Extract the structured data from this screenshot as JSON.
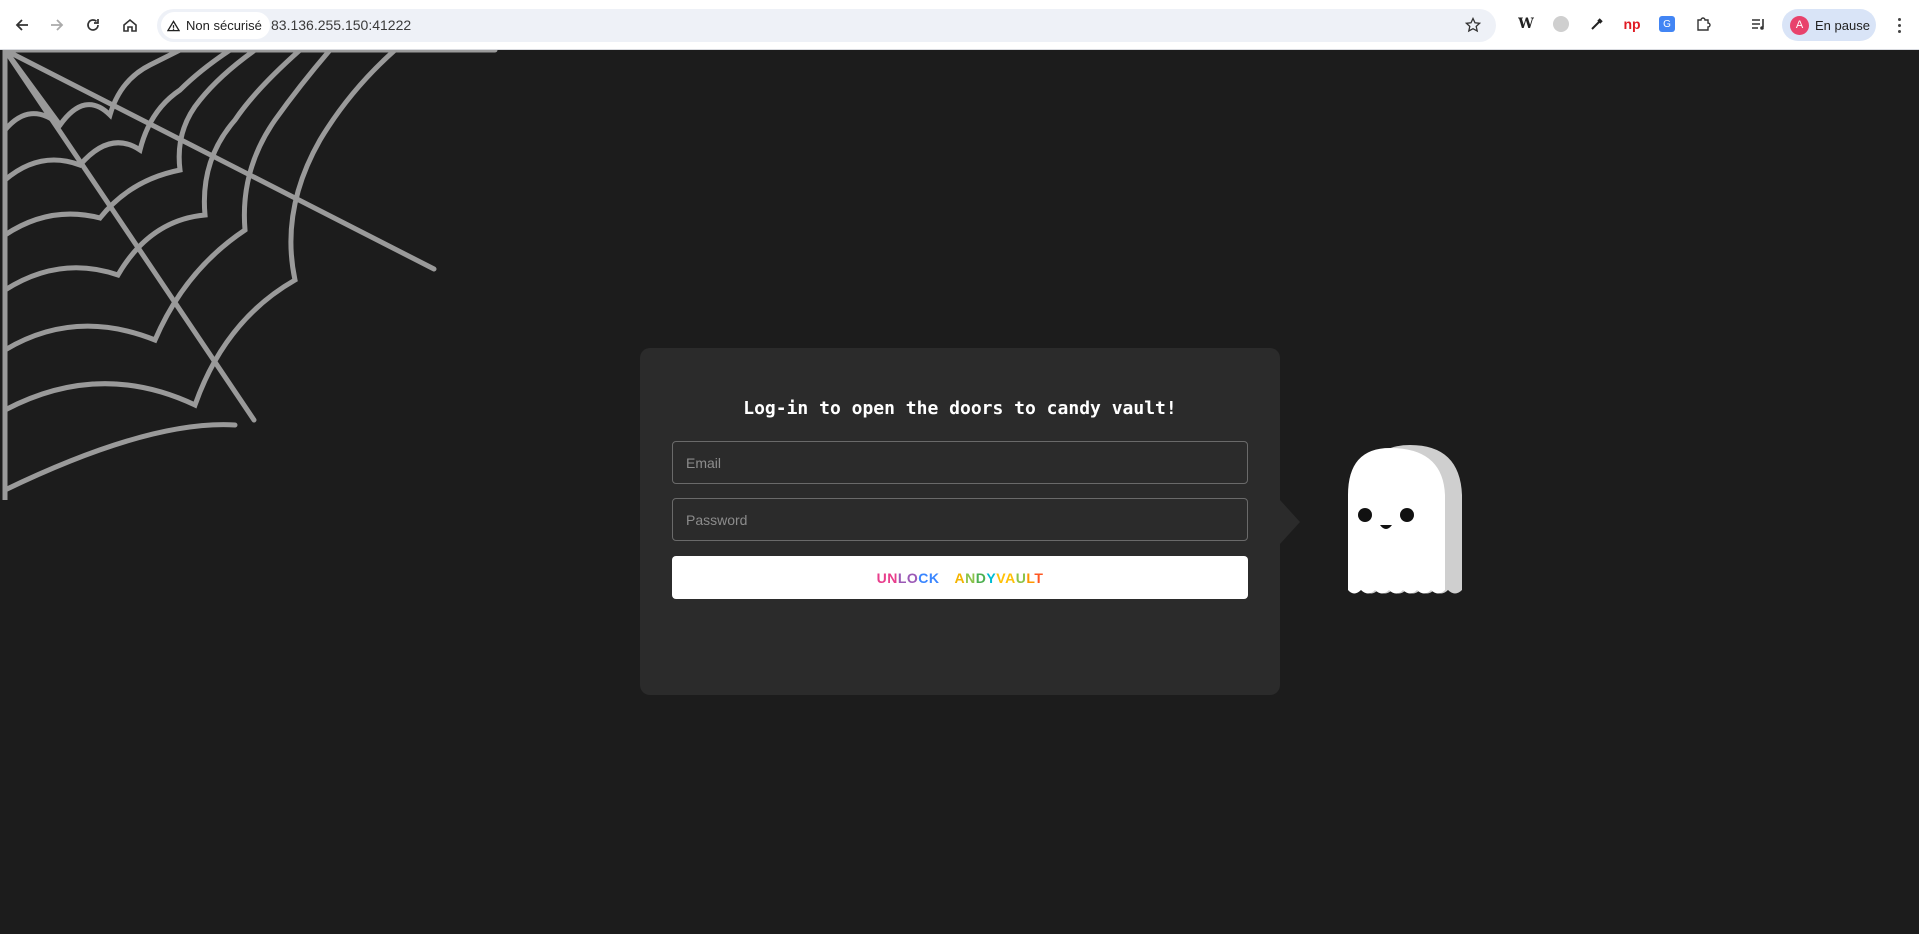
{
  "browser": {
    "security_label": "Non sécurisé",
    "url": "83.136.255.150:41222",
    "profile_label": "En pause",
    "profile_initial": "A"
  },
  "icons": [
    "back-icon",
    "forward-icon",
    "reload-icon",
    "home-icon",
    "warning-icon",
    "star-icon",
    "wikipedia-extension-icon",
    "extension-c-icon",
    "eyedropper-icon",
    "np-extension-icon",
    "translate-extension-icon",
    "puzzle-extensions-icon",
    "reading-list-icon",
    "menu-icon",
    "spider-web-icon",
    "ghost-icon"
  ],
  "login": {
    "title": "Log-in to open the doors to candy vault!",
    "email_placeholder": "Email",
    "password_placeholder": "Password",
    "button_label": "UNLOCK CANDYVAULT",
    "button_letter_colors": [
      "#e83e8c",
      "#e83e8c",
      "#9b59b6",
      "#9b59b6",
      "#3a86ff",
      "#3a86ff",
      "#ffffff",
      "#f4b400",
      "#8bc34a",
      "#4caf50",
      "#00bcd4",
      "#ffc107",
      "#ffc107",
      "#8bc34a",
      "#ff9800",
      "#ff5722",
      "#ff9800"
    ]
  },
  "colors": {
    "page_background": "#1c1c1c",
    "card_background": "#2b2b2b",
    "web_stroke": "#9a9a9a"
  }
}
